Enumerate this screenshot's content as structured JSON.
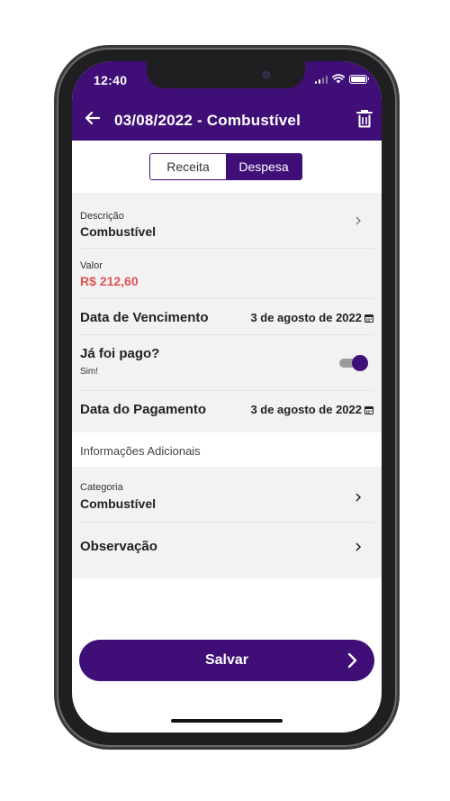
{
  "status_bar": {
    "time": "12:40"
  },
  "app_bar": {
    "title": "03/08/2022 - Combustível"
  },
  "type_toggle": {
    "options": [
      "Receita",
      "Despesa"
    ],
    "selected": "Despesa"
  },
  "form": {
    "descricao": {
      "label": "Descrição",
      "value": "Combustível"
    },
    "valor": {
      "label": "Valor",
      "value": "R$ 212,60",
      "color": "#e05454"
    },
    "vencimento": {
      "label": "Data de Vencimento",
      "value": "3 de agosto de 2022"
    },
    "pago": {
      "label": "Já foi pago?",
      "sub": "Sim!",
      "on": true
    },
    "pagamento": {
      "label": "Data do Pagamento",
      "value": "3 de agosto de 2022"
    }
  },
  "additional": {
    "header": "Informações Adicionais",
    "categoria": {
      "label": "Categoria",
      "value": "Combustível"
    },
    "observacao": {
      "label": "Observação"
    }
  },
  "actions": {
    "save_label": "Salvar"
  },
  "colors": {
    "primary": "#3f0f77",
    "accent_red": "#e05454",
    "card_bg": "#f2f2f2"
  },
  "icons": [
    "back-arrow-icon",
    "trash-icon",
    "chevron-right-icon",
    "calendar-icon",
    "arrow-right-icon",
    "signal-icon",
    "wifi-icon",
    "battery-icon"
  ]
}
